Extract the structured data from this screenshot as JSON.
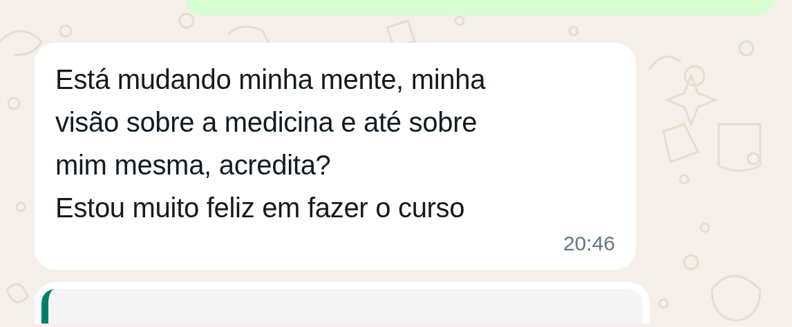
{
  "messages": [
    {
      "kind": "outgoing"
    },
    {
      "kind": "incoming",
      "lines": [
        "Está mudando minha mente, minha",
        "visão sobre a medicina e até sobre",
        "mim mesma, acredita?",
        "Estou muito feliz em fazer o curso"
      ],
      "time": "20:46"
    },
    {
      "kind": "incoming-quote"
    }
  ]
}
